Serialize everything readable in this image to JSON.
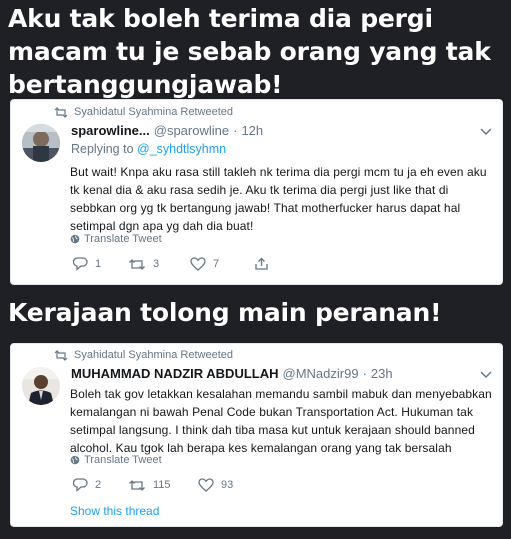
{
  "headings": {
    "first": "Aku tak boleh terima dia pergi macam tu je sebab orang yang tak bertanggungjawab!",
    "second": "Kerajaan tolong main peranan!"
  },
  "tweets": [
    {
      "retweeted_by": "Syahidatul Syahmina Retweeted",
      "name": "sparowline...",
      "handle": "@sparowline",
      "dot": "·",
      "time": "12h",
      "reply_prefix": "Replying to ",
      "reply_handle": "@_syhdtlsyhmn",
      "text": "But wait! Knpa aku rasa still takleh nk terima dia pergi mcm tu ja eh even aku tk kenal dia & aku rasa sedih je. Aku tk terima dia pergi just like that di sebbkan org yg tk bertangung jawab! That motherfucker harus dapat hal setimpal dgn apa yg dah dia buat!",
      "translate": "Translate Tweet",
      "replies": "1",
      "retweets": "3",
      "likes": "7"
    },
    {
      "retweeted_by": "Syahidatul Syahmina Retweeted",
      "name": "MUHAMMAD NADZIR ABDULLAH",
      "handle": "@MNadzir99",
      "dot": "·",
      "time": "23h",
      "text": "Boleh tak gov letakkan kesalahan memandu sambil mabuk dan menyebabkan kemalangan ni bawah Penal Code bukan Transportation Act. Hukuman tak setimpal langsung. I think dah tiba masa kut untuk kerajaan should banned alcohol. Kau tgok lah berapa kes kemalangan orang yang tak bersalah",
      "translate": "Translate Tweet",
      "replies": "2",
      "retweets": "115",
      "likes": "93",
      "show_thread": "Show this thread"
    }
  ],
  "icons": {
    "retweet": "retweet-icon",
    "reply": "reply-icon",
    "like": "heart-icon",
    "dm": "direct-message-icon",
    "globe": "globe-icon",
    "more": "chevron-down-icon"
  },
  "colors": {
    "background": "#1f1f26",
    "link": "#1da1f2",
    "muted": "#657786",
    "text": "#14171a"
  }
}
